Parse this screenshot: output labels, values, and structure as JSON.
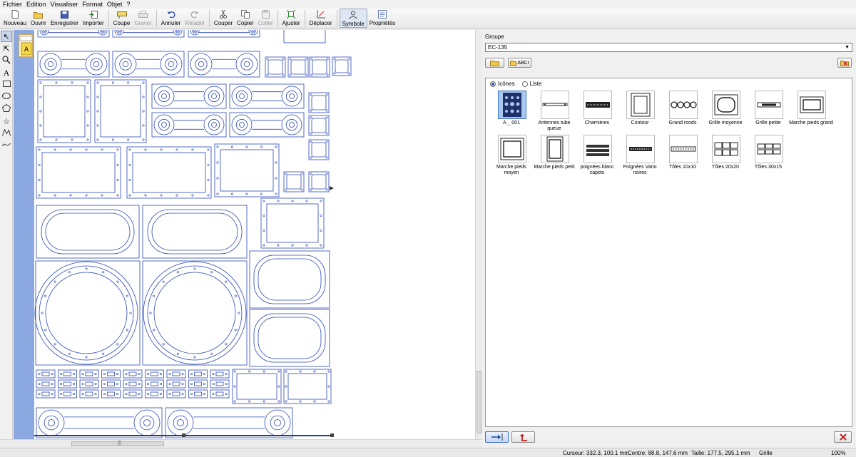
{
  "menu": [
    "Fichier",
    "Edition",
    "Visualiser",
    "Format",
    "Objet",
    "?"
  ],
  "toolbar": {
    "nouveau": "Nouveau",
    "ouvrir": "Ouvrir",
    "enregistrer": "Enregistrer",
    "importer": "Importer",
    "coupe": "Coupe",
    "graver": "Graver",
    "annuler": "Annuler",
    "retablir": "Rétablir",
    "couper": "Couper",
    "copier": "Copier",
    "coller": "Coller",
    "ajuster": "Ajuster",
    "deplacer": "Déplacer",
    "symbole": "Symbole",
    "proprietes": "Propriétés"
  },
  "left_tools": [
    "pointer-icon",
    "node-edit-icon",
    "zoom-icon",
    "text-icon",
    "rectangle-icon",
    "ellipse-icon",
    "polygon-icon",
    "star-icon",
    "polyline-icon",
    "curve-icon"
  ],
  "layer_chip": "A",
  "panel": {
    "group_label": "Groupe",
    "group_value": "EC-135",
    "abci_label": "ABCI",
    "view_icons": "Icônes",
    "view_list": "Liste",
    "symbols": [
      "A _ 001",
      "Antennes tube queue",
      "Charnières",
      "Contour",
      "Grand ronds",
      "Grille moyenne",
      "Grille petite",
      "Marche pieds grand",
      "Marche pieds moyen",
      "Marche pieds petit",
      "poignées blanc capots",
      "Poignées Vario noires",
      "Tôles 10x10",
      "Tôles 20x20",
      "Tôles 30x15"
    ]
  },
  "status": {
    "cursor": "Curseur: 332.3, 100.1 mm",
    "center": "Centre: 88.8, 147.6 mm",
    "size": "Taille: 177.5, 295.1 mm",
    "grid": "Grille",
    "zoom": "100%"
  },
  "colors": {
    "shape_stroke": "#2a47b8",
    "ruler": "#8ca8e0",
    "selection": "#a9c8ee"
  }
}
